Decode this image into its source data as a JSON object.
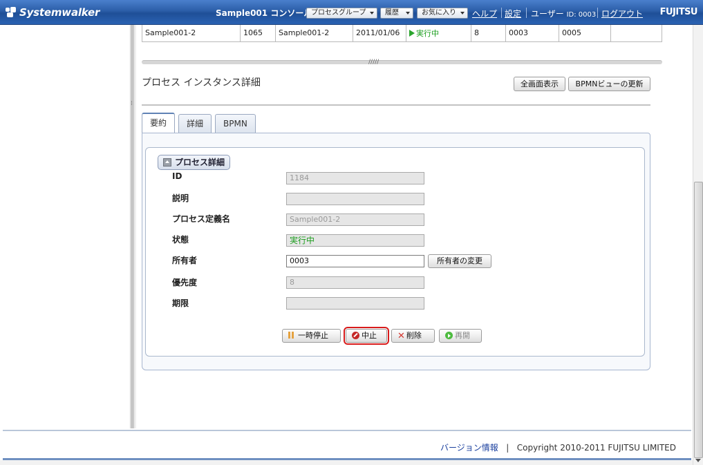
{
  "header": {
    "logo": "Systemwalker",
    "title": "Sample001 コンソール",
    "menus": [
      "プロセスグループ",
      "履歴",
      "お気に入り"
    ],
    "help": "ヘルプ",
    "settings": "設定",
    "user_label": "ユーザー",
    "user_id": "ID: 0003",
    "logout": "ログアウト",
    "brand": "FUJITSU"
  },
  "instance_row": {
    "cells": [
      "Sample001-2",
      "1065",
      "Sample001-2",
      "2011/01/06",
      "実行中",
      "8",
      "0003",
      "0005",
      ""
    ]
  },
  "section": {
    "title": "プロセス インスタンス詳細",
    "fullscreen": "全画面表示",
    "refresh_bpmn": "BPMNビューの更新"
  },
  "tabs": [
    "要約",
    "詳細",
    "BPMN"
  ],
  "details": {
    "legend": "プロセス詳細",
    "labels": {
      "id": "ID",
      "description": "説明",
      "process_def": "プロセス定義名",
      "state": "状態",
      "owner": "所有者",
      "priority": "優先度",
      "due": "期限"
    },
    "values": {
      "id": "1184",
      "description": "",
      "process_def": "Sample001-2",
      "state": "実行中",
      "owner": "0003",
      "priority": "8",
      "due": ""
    },
    "change_owner": "所有者の変更"
  },
  "actions": {
    "suspend": "一時停止",
    "abort": "中止",
    "delete": "削除",
    "resume": "再開"
  },
  "footer": {
    "version": "バージョン情報",
    "separator": "|",
    "copyright": "Copyright 2010-2011 FUJITSU LIMITED"
  }
}
